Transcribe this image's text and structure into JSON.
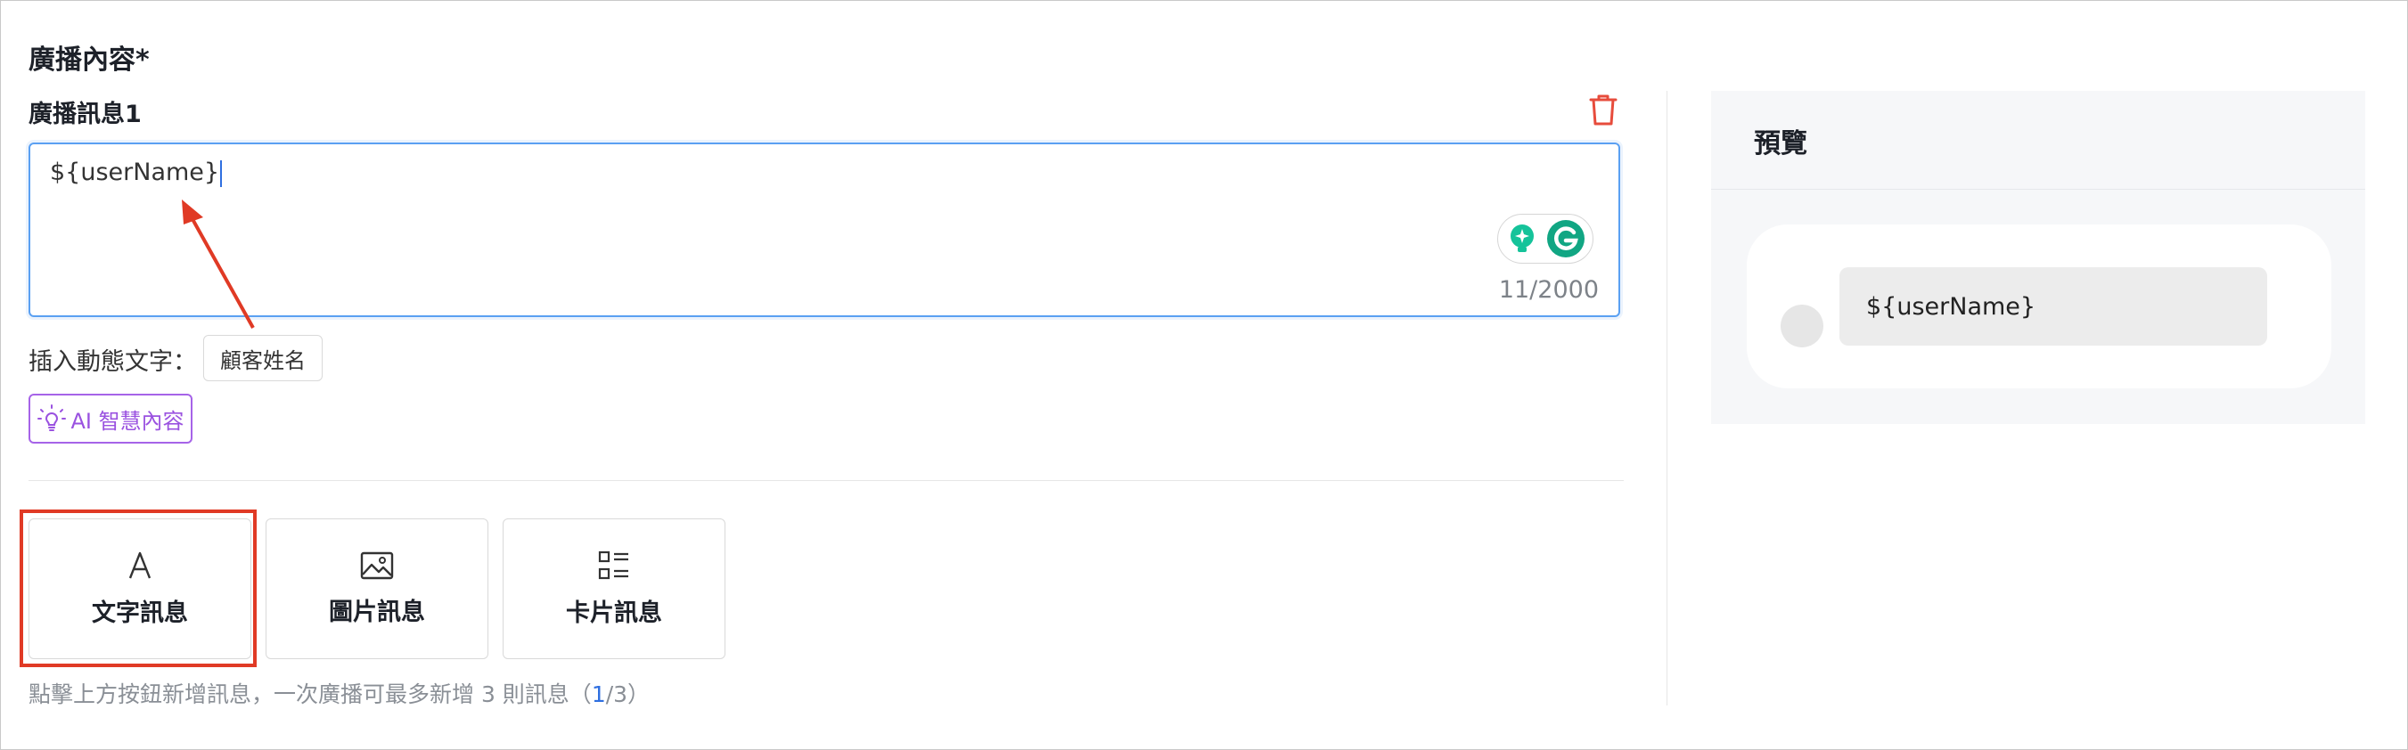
{
  "form": {
    "section_title": "廣播內容*",
    "message_title": "廣播訊息1",
    "editor_text": "${userName}",
    "char_counter": "11/2000",
    "insert_label": "插入動態文字：",
    "insert_chip": "顧客姓名",
    "ai_button": "AI 智慧內容"
  },
  "message_types": [
    {
      "label": "文字訊息",
      "icon": "text-a-icon"
    },
    {
      "label": "圖片訊息",
      "icon": "image-icon"
    },
    {
      "label": "卡片訊息",
      "icon": "card-list-icon"
    }
  ],
  "hint": {
    "prefix": "點擊上方按鈕新增訊息，一次廣播可最多新增 3 則訊息（",
    "count": "1",
    "suffix": "/3）"
  },
  "preview": {
    "title": "預覽",
    "bubble_text": "${userName}"
  },
  "colors": {
    "accent_blue": "#5aa0f2",
    "delete_red": "#e74c3c",
    "ai_purple": "#9a52e0",
    "highlight_red": "#e03a25"
  }
}
